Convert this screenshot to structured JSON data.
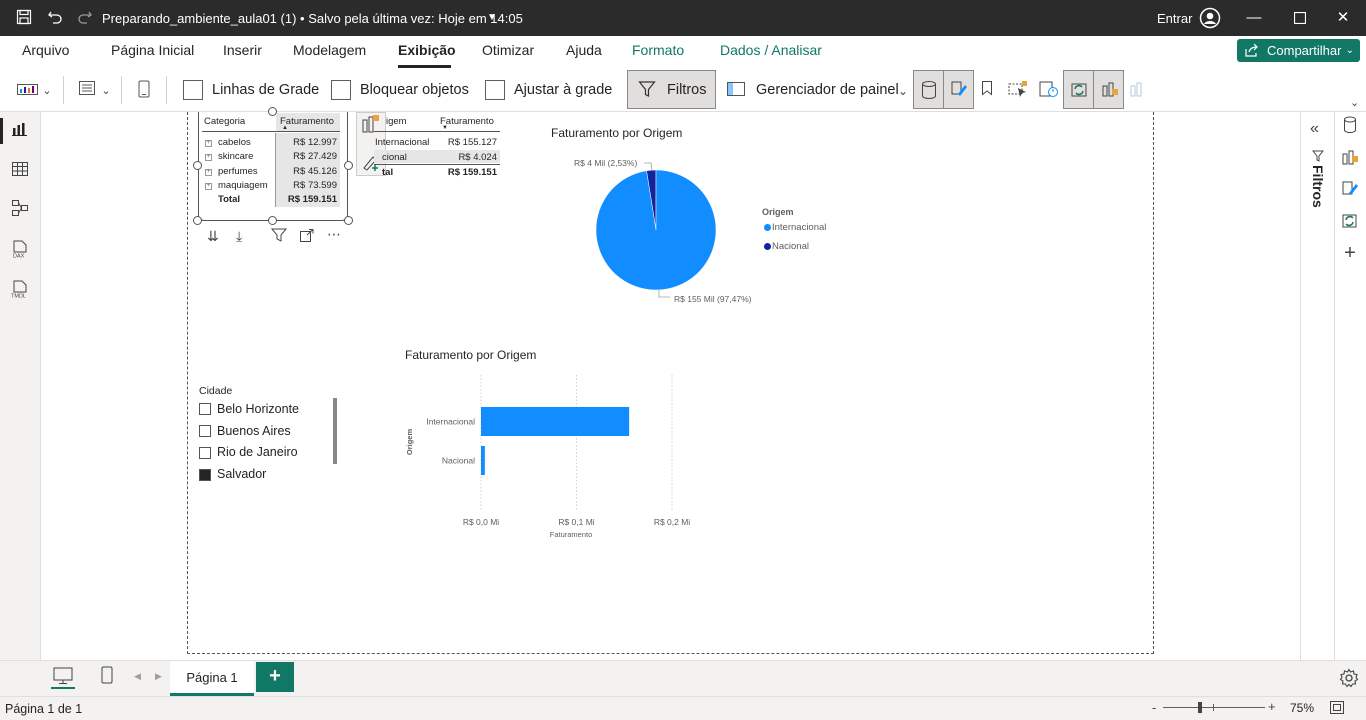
{
  "titlebar": {
    "title": "Preparando_ambiente_aula01 (1) • Salvo pela última vez: Hoje em 14:05",
    "signin": "Entrar",
    "icons": [
      "save-icon",
      "undo-icon",
      "redo-icon",
      "chevron-down-icon",
      "user-icon",
      "minimize-icon",
      "maximize-icon",
      "close-icon"
    ]
  },
  "menu": {
    "tabs": [
      {
        "label": "Arquivo"
      },
      {
        "label": "Página Inicial"
      },
      {
        "label": "Inserir"
      },
      {
        "label": "Modelagem"
      },
      {
        "label": "Exibição",
        "active": true
      },
      {
        "label": "Otimizar"
      },
      {
        "label": "Ajuda"
      },
      {
        "label": "Formato",
        "context": true
      },
      {
        "label": "Dados / Analisar",
        "context": true
      }
    ],
    "share_label": "Compartilhar"
  },
  "ribbon": {
    "gridlines_label": "Linhas de Grade",
    "lock_label": "Bloquear objetos",
    "snap_label": "Ajustar à grade",
    "filters_label": "Filtros",
    "panel_manager_label": "Gerenciador de painel"
  },
  "matrix": {
    "col_category": "Categoria",
    "col_value": "Faturamento",
    "rows": [
      {
        "label": "cabelos",
        "value": "R$ 12.997"
      },
      {
        "label": "skincare",
        "value": "R$ 27.429"
      },
      {
        "label": "perfumes",
        "value": "R$ 45.126"
      },
      {
        "label": "maquiagem",
        "value": "R$ 73.599"
      }
    ],
    "total_label": "Total",
    "total_value": "R$ 159.151"
  },
  "table2": {
    "col_origin": "igem",
    "col_value": "Faturamento",
    "rows": [
      {
        "label": "Internacional",
        "value": "R$ 155.127"
      },
      {
        "label": "cional",
        "value": "R$ 4.024"
      }
    ],
    "total_label": "tal",
    "total_value": "R$ 159.151"
  },
  "slicer": {
    "title": "Cidade",
    "items": [
      {
        "label": "Belo Horizonte",
        "checked": false
      },
      {
        "label": "Buenos Aires",
        "checked": false
      },
      {
        "label": "Rio de Janeiro",
        "checked": false
      },
      {
        "label": "Salvador",
        "checked": true
      }
    ]
  },
  "chart_data": [
    {
      "type": "pie",
      "title": "Faturamento por Origem",
      "legend_title": "Origem",
      "legend_position": "right",
      "categories": [
        "Internacional",
        "Nacional"
      ],
      "values": [
        155127,
        4024
      ],
      "data_labels": [
        "R$ 155 Mil (97,47%)",
        "R$ 4 Mil (2,53%)"
      ],
      "colors": [
        "#118dff",
        "#12239e"
      ]
    },
    {
      "type": "bar",
      "title": "Faturamento por Origem",
      "categories": [
        "Internacional",
        "Nacional"
      ],
      "values": [
        155127,
        4024
      ],
      "xlabel": "Faturamento",
      "ylabel": "Origem",
      "xlim": [
        0,
        200000
      ],
      "x_ticks": [
        "R$ 0,0 Mi",
        "R$ 0,1 Mi",
        "R$ 0,2 Mi"
      ],
      "grid": true,
      "color": "#118dff"
    }
  ],
  "bottom": {
    "page_tab": "Página 1",
    "add_label": "+",
    "status": "Página 1 de 1",
    "zoom": "75%"
  },
  "colors": {
    "accent": "#117865",
    "primary_series": "#118dff",
    "secondary_series": "#12239e"
  }
}
